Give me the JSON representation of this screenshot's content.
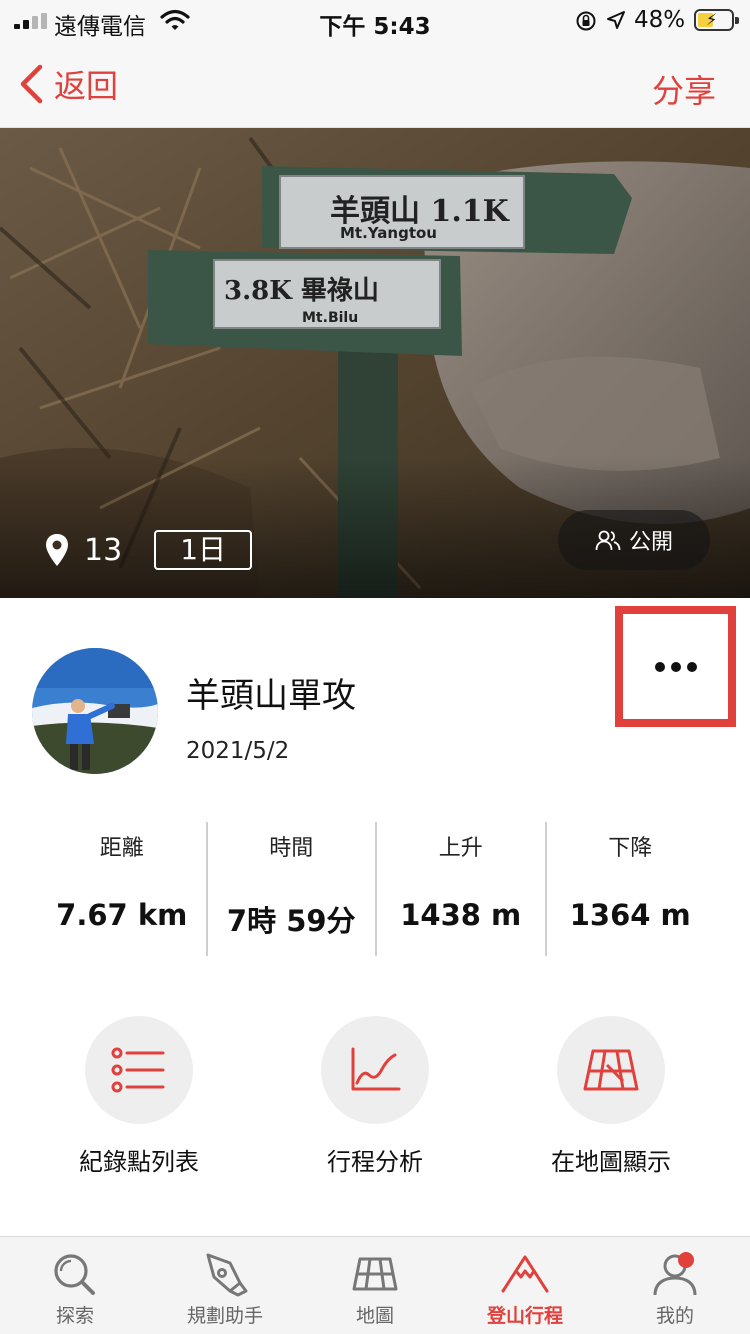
{
  "status_bar": {
    "carrier": "遠傳電信",
    "time": "下午 5:43",
    "battery_percent": "48%",
    "battery_level": 0.48,
    "icons": [
      "signal-icon",
      "wifi-icon",
      "orientation-lock-icon",
      "location-arrow-icon",
      "battery-charging-icon"
    ]
  },
  "nav": {
    "back_label": "返回",
    "share_label": "分享"
  },
  "hero": {
    "photo_description_icon": "trail-sign-photo",
    "waypoint_count": "13",
    "days_label": "1日",
    "visibility_label": "公開",
    "sign_top_text": "羊頭山 1.1K",
    "sign_top_sub": "Mt.Yangtou",
    "sign_bottom_text": "3.8K 畢祿山",
    "sign_bottom_sub": "Mt.Bilu"
  },
  "trip": {
    "title": "羊頭山單攻",
    "date": "2021/5/2"
  },
  "stats": [
    {
      "label": "距離",
      "value": "7.67 km"
    },
    {
      "label": "時間",
      "value": "7時 59分"
    },
    {
      "label": "上升",
      "value": "1438 m"
    },
    {
      "label": "下降",
      "value": "1364 m"
    }
  ],
  "actions": [
    {
      "label": "紀錄點列表",
      "icon": "list-icon"
    },
    {
      "label": "行程分析",
      "icon": "line-chart-icon"
    },
    {
      "label": "在地圖顯示",
      "icon": "map-icon"
    }
  ],
  "tabs": [
    {
      "label": "探索",
      "icon": "search-icon",
      "active": false
    },
    {
      "label": "規劃助手",
      "icon": "pen-nib-icon",
      "active": false
    },
    {
      "label": "地圖",
      "icon": "map-icon",
      "active": false
    },
    {
      "label": "登山行程",
      "icon": "mountain-icon",
      "active": true
    },
    {
      "label": "我的",
      "icon": "profile-icon",
      "active": false
    }
  ],
  "colors": {
    "accent": "#e0413c",
    "bar_background": "#f7f7f7",
    "action_circle": "#eeeeee"
  }
}
